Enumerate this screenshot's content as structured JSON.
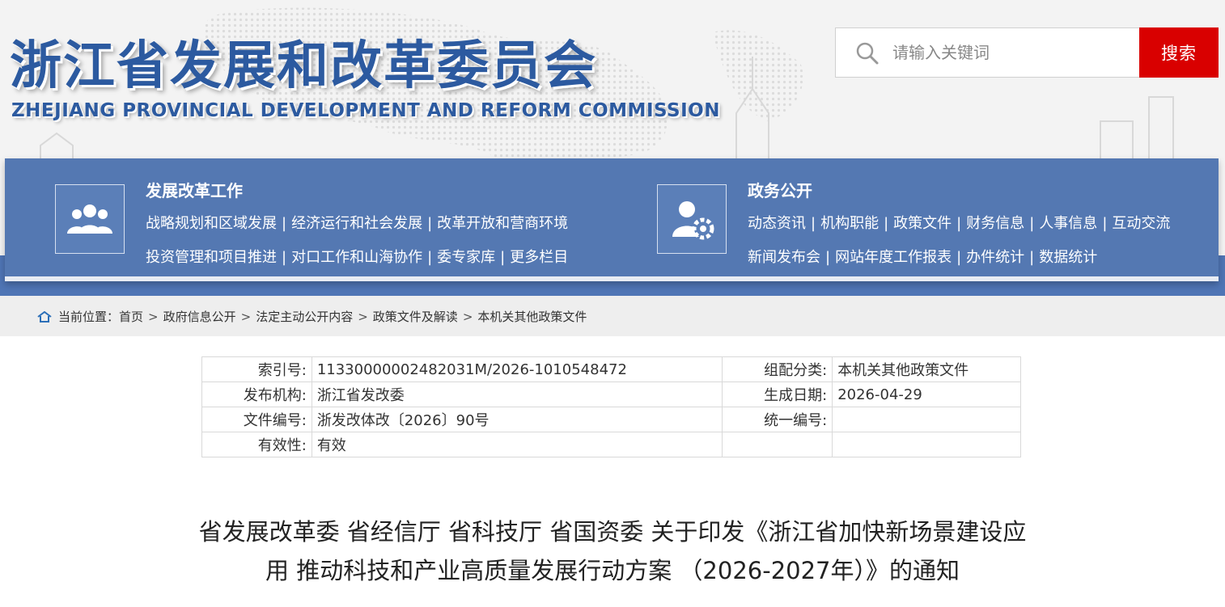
{
  "header": {
    "org_name_cn": "浙江省发展和改革委员会",
    "org_name_en": "ZHEJIANG PROVINCIAL DEVELOPMENT AND REFORM COMMISSION",
    "search": {
      "placeholder": "请输入关键词",
      "button_label": "搜索"
    }
  },
  "nav": {
    "groups": [
      {
        "title": "发展改革工作",
        "icon": "people-group-icon",
        "lines": [
          [
            "战略规划和区域发展",
            "经济运行和社会发展",
            "改革开放和营商环境"
          ],
          [
            "投资管理和项目推进",
            "对口工作和山海协作",
            "委专家库",
            "更多栏目"
          ]
        ]
      },
      {
        "title": "政务公开",
        "icon": "user-gear-icon",
        "lines": [
          [
            "动态资讯",
            "机构职能",
            "政策文件",
            "财务信息",
            "人事信息",
            "互动交流"
          ],
          [
            "新闻发布会",
            "网站年度工作报表",
            "办件统计",
            "数据统计"
          ]
        ]
      }
    ]
  },
  "breadcrumb": {
    "prefix": "当前位置：",
    "items": [
      "首页",
      "政府信息公开",
      "法定主动公开内容",
      "政策文件及解读",
      "本机关其他政策文件"
    ]
  },
  "info_table": {
    "rows": [
      {
        "l1": "索引号:",
        "v1": "11330000002482031M/2026-1010548472",
        "l2": "组配分类:",
        "v2": "本机关其他政策文件"
      },
      {
        "l1": "发布机构:",
        "v1": "浙江省发改委",
        "l2": "生成日期:",
        "v2": "2026-04-29"
      },
      {
        "l1": "文件编号:",
        "v1": "浙发改体改〔2026〕90号",
        "l2": "统一编号:",
        "v2": ""
      },
      {
        "l1": "有效性:",
        "v1": "有效",
        "l2": "",
        "v2": ""
      }
    ]
  },
  "document": {
    "title_line1": "省发展改革委 省经信厅 省科技厅 省国资委 关于印发《浙江省加快新场景建设应",
    "title_line2": "用 推动科技和产业高质量发展行动方案 （2026-2027年）》的通知"
  },
  "colors": {
    "brand_blue": "#2c5aa0",
    "nav_blue": "#5478b2",
    "search_red": "#d90000"
  }
}
